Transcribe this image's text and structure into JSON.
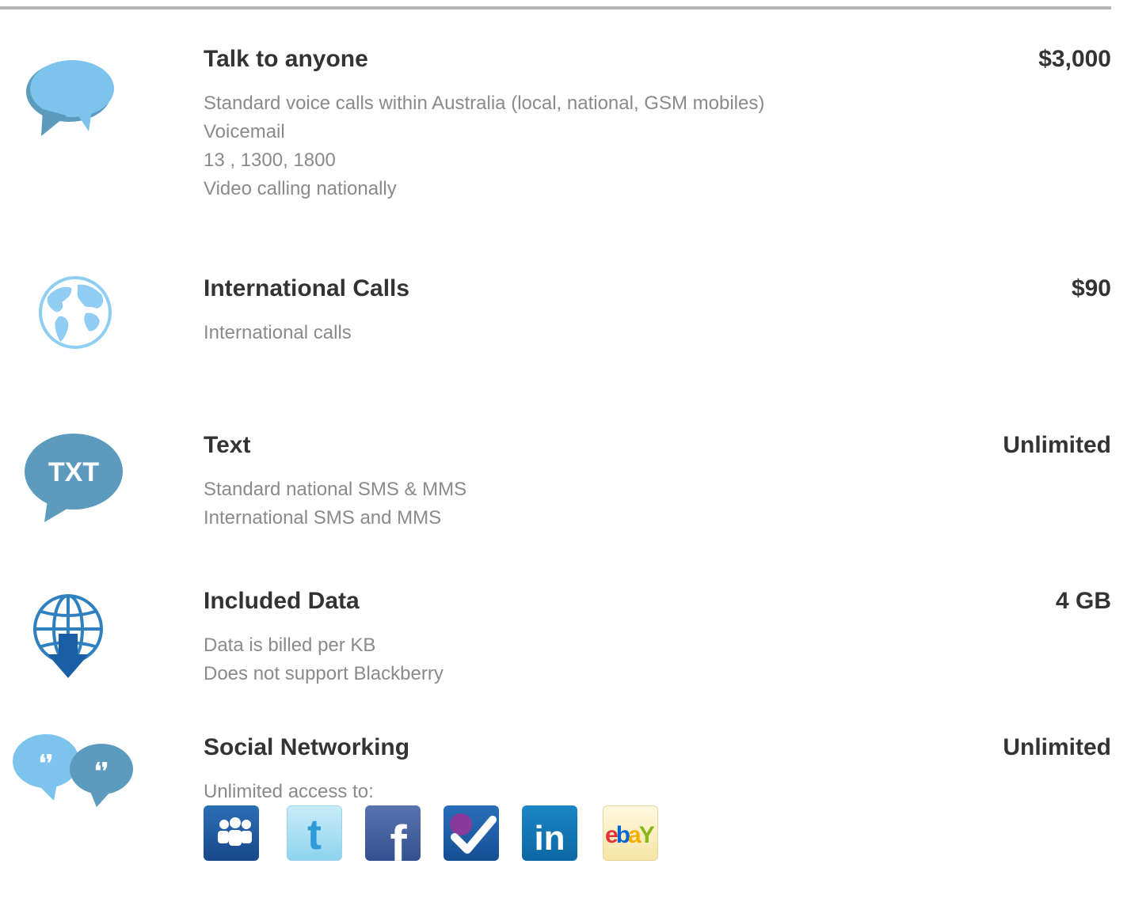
{
  "colors": {
    "title": "#333333",
    "description": "#8a8a8a",
    "bubble_light": "#7cc4ee",
    "bubble_dark": "#5c9bbd",
    "globe": "#8fcdf2",
    "data_globe": "#2f80c0",
    "divider": "#b4b4b4"
  },
  "features": [
    {
      "icon": "speech-bubble-icon",
      "title": "Talk to anyone",
      "value": "$3,000",
      "lines": [
        "Standard voice calls within Australia (local, national, GSM mobiles)",
        "Voicemail",
        "13 , 1300, 1800",
        "Video calling nationally"
      ]
    },
    {
      "icon": "world-globe-icon",
      "title": "International Calls",
      "value": "$90",
      "lines": [
        "International calls"
      ]
    },
    {
      "icon": "txt-bubble-icon",
      "icon_text": "TXT",
      "title": "Text",
      "value": "Unlimited",
      "lines": [
        "Standard national SMS & MMS",
        "International SMS and MMS"
      ]
    },
    {
      "icon": "data-download-globe-icon",
      "title": "Included Data",
      "value": "4 GB",
      "lines": [
        "Data is billed per KB",
        "Does not support Blackberry"
      ]
    },
    {
      "icon": "social-chat-bubbles-icon",
      "title": "Social Networking",
      "value": "Unlimited",
      "lines": [
        "Unlimited access to:"
      ],
      "networks": [
        {
          "name": "myspace",
          "icon": "myspace-icon"
        },
        {
          "name": "twitter",
          "icon": "twitter-icon",
          "glyph": "t"
        },
        {
          "name": "facebook",
          "icon": "facebook-icon",
          "glyph": "f"
        },
        {
          "name": "foursquare",
          "icon": "foursquare-icon"
        },
        {
          "name": "linkedin",
          "icon": "linkedin-icon",
          "glyph": "in"
        },
        {
          "name": "ebay",
          "icon": "ebay-icon",
          "glyph": "ebY"
        }
      ]
    }
  ]
}
